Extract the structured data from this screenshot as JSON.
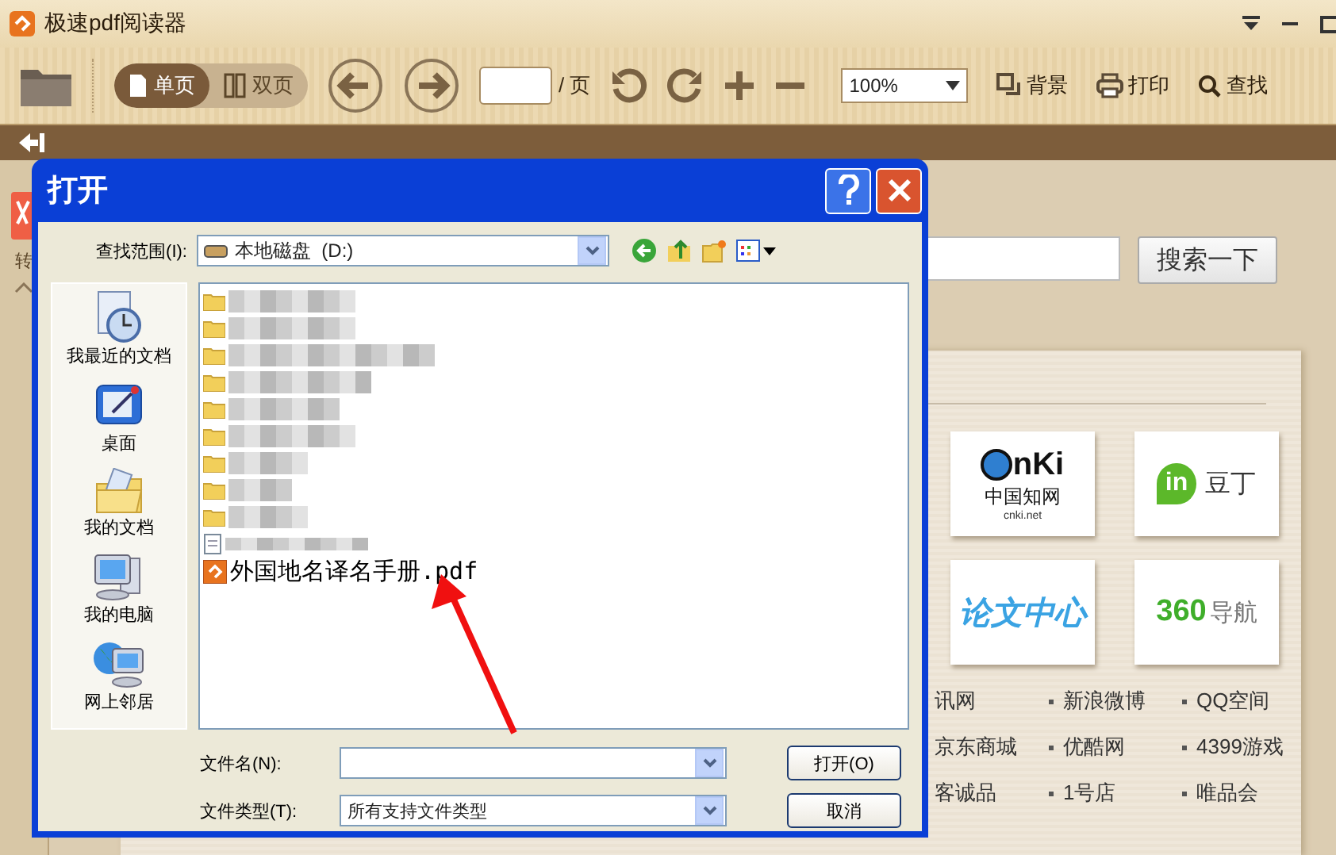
{
  "app": {
    "title": "极速pdf阅读器"
  },
  "toolbar": {
    "view_modes": [
      {
        "label": "单页",
        "selected": true
      },
      {
        "label": "双页",
        "selected": false
      }
    ],
    "page_suffix": "/ 页",
    "zoom": "100%",
    "actions": [
      {
        "kind": "background",
        "label": "背景"
      },
      {
        "kind": "print",
        "label": "打印"
      },
      {
        "kind": "find",
        "label": "查找"
      }
    ]
  },
  "sidebar": {
    "tab_label": "转"
  },
  "search": {
    "button": "搜索一下"
  },
  "sites": {
    "tiles": [
      {
        "kind": "cnki",
        "wordmark": "nKi",
        "label": "中国知网",
        "caption": "cnki.net"
      },
      {
        "kind": "docin",
        "wordmark": "in",
        "label": "豆丁"
      },
      {
        "kind": "lunwen",
        "label": "论文中心"
      },
      {
        "kind": "nav360",
        "wordmark": "360",
        "label": "导航"
      }
    ],
    "links": [
      "讯网",
      "新浪微博",
      "QQ空间",
      "京东商城",
      "优酷网",
      "4399游戏",
      "客诚品",
      "1号店",
      "唯品会"
    ]
  },
  "dialog": {
    "title": "打开",
    "look_in_label": "查找范围(I):",
    "look_in_value": "本地磁盘  (D:)",
    "places": [
      {
        "kind": "recent",
        "label": "我最近的文档"
      },
      {
        "kind": "desktop",
        "label": "桌面"
      },
      {
        "kind": "documents",
        "label": "我的文档"
      },
      {
        "kind": "computer",
        "label": "我的电脑"
      },
      {
        "kind": "network",
        "label": "网上邻居"
      }
    ],
    "hidden_entries": [
      {
        "kind": "folder"
      },
      {
        "kind": "folder"
      },
      {
        "kind": "folder"
      },
      {
        "kind": "folder"
      },
      {
        "kind": "folder"
      },
      {
        "kind": "folder"
      },
      {
        "kind": "folder"
      },
      {
        "kind": "folder"
      },
      {
        "kind": "folder"
      },
      {
        "kind": "text"
      }
    ],
    "files": [
      {
        "name": "外国地名译名手册.pdf"
      }
    ],
    "filename_label": "文件名(N):",
    "filetype_label": "文件类型(T):",
    "filetype_value": "所有支持文件类型",
    "buttons": [
      "打开(O)",
      "取消"
    ]
  }
}
